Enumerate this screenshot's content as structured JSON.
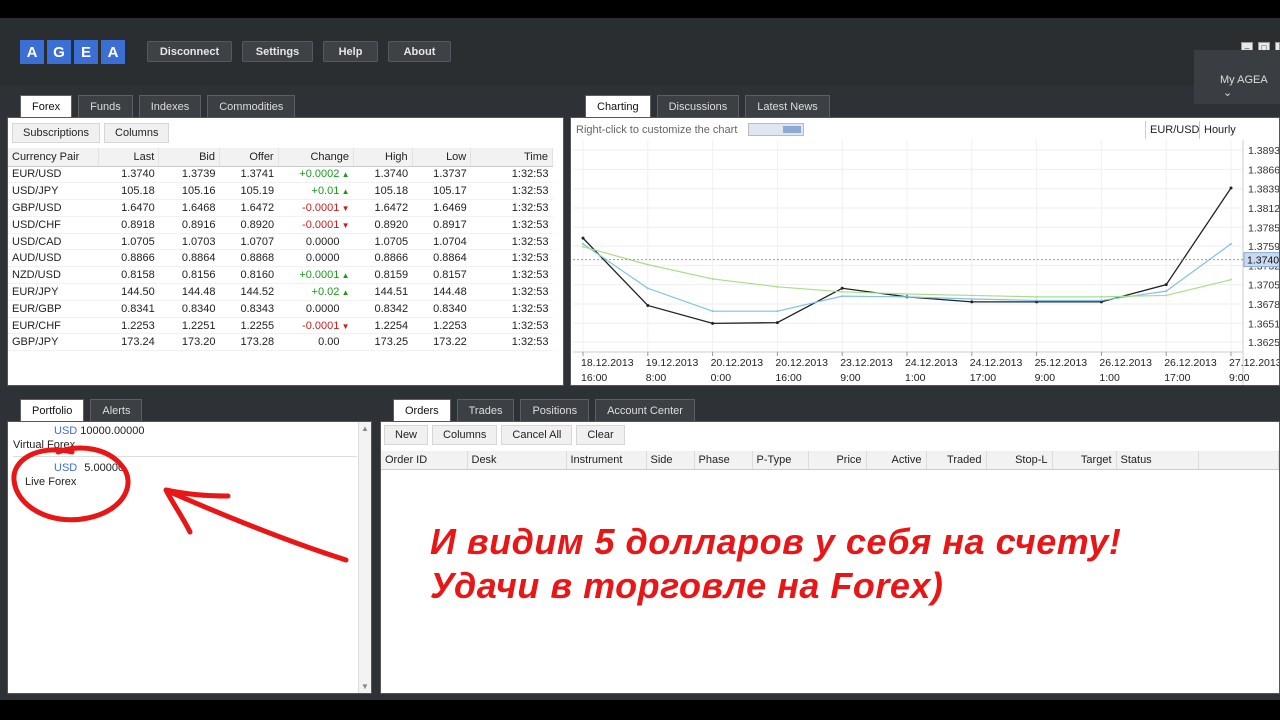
{
  "logo": [
    "A",
    "G",
    "E",
    "A"
  ],
  "topbar": {
    "disconnect": "Disconnect",
    "settings": "Settings",
    "help": "Help",
    "about": "About",
    "my_agea": "My AGEA"
  },
  "quotes": {
    "tabs": [
      "Forex",
      "Funds",
      "Indexes",
      "Commodities"
    ],
    "subscriptions": "Subscriptions",
    "columns": "Columns",
    "headers": [
      "Currency Pair",
      "Last",
      "Bid",
      "Offer",
      "Change",
      "High",
      "Low",
      "Time"
    ],
    "rows": [
      {
        "pair": "EUR/USD",
        "last": "1.3740",
        "bid": "1.3739",
        "offer": "1.3741",
        "change": "+0.0002",
        "dir": "up",
        "high": "1.3740",
        "low": "1.3737",
        "time": "1:32:53"
      },
      {
        "pair": "USD/JPY",
        "last": "105.18",
        "bid": "105.16",
        "offer": "105.19",
        "change": "+0.01",
        "dir": "up",
        "high": "105.18",
        "low": "105.17",
        "time": "1:32:53"
      },
      {
        "pair": "GBP/USD",
        "last": "1.6470",
        "bid": "1.6468",
        "offer": "1.6472",
        "change": "-0.0001",
        "dir": "down",
        "high": "1.6472",
        "low": "1.6469",
        "time": "1:32:53"
      },
      {
        "pair": "USD/CHF",
        "last": "0.8918",
        "bid": "0.8916",
        "offer": "0.8920",
        "change": "-0.0001",
        "dir": "down",
        "high": "0.8920",
        "low": "0.8917",
        "time": "1:32:53"
      },
      {
        "pair": "USD/CAD",
        "last": "1.0705",
        "bid": "1.0703",
        "offer": "1.0707",
        "change": "0.0000",
        "dir": "",
        "high": "1.0705",
        "low": "1.0704",
        "time": "1:32:53"
      },
      {
        "pair": "AUD/USD",
        "last": "0.8866",
        "bid": "0.8864",
        "offer": "0.8868",
        "change": "0.0000",
        "dir": "",
        "high": "0.8866",
        "low": "0.8864",
        "time": "1:32:53"
      },
      {
        "pair": "NZD/USD",
        "last": "0.8158",
        "bid": "0.8156",
        "offer": "0.8160",
        "change": "+0.0001",
        "dir": "up",
        "high": "0.8159",
        "low": "0.8157",
        "time": "1:32:53"
      },
      {
        "pair": "EUR/JPY",
        "last": "144.50",
        "bid": "144.48",
        "offer": "144.52",
        "change": "+0.02",
        "dir": "up",
        "high": "144.51",
        "low": "144.48",
        "time": "1:32:53"
      },
      {
        "pair": "EUR/GBP",
        "last": "0.8341",
        "bid": "0.8340",
        "offer": "0.8343",
        "change": "0.0000",
        "dir": "",
        "high": "0.8342",
        "low": "0.8340",
        "time": "1:32:53"
      },
      {
        "pair": "EUR/CHF",
        "last": "1.2253",
        "bid": "1.2251",
        "offer": "1.2255",
        "change": "-0.0001",
        "dir": "down",
        "high": "1.2254",
        "low": "1.2253",
        "time": "1:32:53"
      },
      {
        "pair": "GBP/JPY",
        "last": "173.24",
        "bid": "173.20",
        "offer": "173.28",
        "change": "0.00",
        "dir": "",
        "high": "173.25",
        "low": "173.22",
        "time": "1:32:53"
      }
    ]
  },
  "chart": {
    "tabs": [
      "Charting",
      "Discussions",
      "Latest News"
    ],
    "hint": "Right-click to customize the chart",
    "symbol": "EUR/USD",
    "interval": "Hourly",
    "yticks": [
      "1.3893",
      "1.3866",
      "1.3839",
      "1.3812",
      "1.3785",
      "1.3759",
      "1.3732",
      "1.3705",
      "1.3678",
      "1.3651",
      "1.3625"
    ],
    "last_price": "1.3740",
    "xticks": [
      [
        "18.12.2013",
        "16:00"
      ],
      [
        "19.12.2013",
        "8:00"
      ],
      [
        "20.12.2013",
        "0:00"
      ],
      [
        "20.12.2013",
        "16:00"
      ],
      [
        "23.12.2013",
        "9:00"
      ],
      [
        "24.12.2013",
        "1:00"
      ],
      [
        "24.12.2013",
        "17:00"
      ],
      [
        "25.12.2013",
        "9:00"
      ],
      [
        "26.12.2013",
        "1:00"
      ],
      [
        "26.12.2013",
        "17:00"
      ],
      [
        "27.12.2013",
        "9:00"
      ]
    ]
  },
  "chart_data": {
    "type": "line",
    "title": "",
    "xlabel": "",
    "ylabel": "",
    "ylim": [
      1.3611,
      1.3907
    ],
    "x": [
      "18.12.2013 16:00",
      "19.12.2013 8:00",
      "20.12.2013 0:00",
      "20.12.2013 16:00",
      "23.12.2013 9:00",
      "24.12.2013 1:00",
      "24.12.2013 17:00",
      "25.12.2013 9:00",
      "26.12.2013 1:00",
      "26.12.2013 17:00",
      "27.12.2013 9:00"
    ],
    "series": [
      {
        "color": "#222222",
        "values": [
          1.377,
          1.3676,
          1.3651,
          1.3652,
          1.37,
          1.3688,
          1.3681,
          1.3681,
          1.3681,
          1.3705,
          1.384
        ]
      },
      {
        "color": "#7ec3e6",
        "values": [
          1.3762,
          1.37,
          1.3668,
          1.3668,
          1.3689,
          1.3688,
          1.3685,
          1.3683,
          1.3683,
          1.3696,
          1.3762
        ]
      },
      {
        "color": "#a8dd8a",
        "values": [
          1.3758,
          1.3733,
          1.3713,
          1.3702,
          1.3695,
          1.3692,
          1.369,
          1.3688,
          1.3688,
          1.369,
          1.3712
        ]
      }
    ]
  },
  "portfolio": {
    "tabs": [
      "Portfolio",
      "Alerts"
    ],
    "accounts": [
      {
        "currency": "USD",
        "amount": "10000.00000",
        "name": "Virtual Forex"
      },
      {
        "currency": "USD",
        "amount": "5.00000",
        "name": "Live Forex"
      }
    ]
  },
  "orders": {
    "tabs": [
      "Orders",
      "Trades",
      "Positions",
      "Account Center"
    ],
    "buttons": [
      "New",
      "Columns",
      "Cancel All",
      "Clear"
    ],
    "headers": [
      "Order ID",
      "Desk",
      "Instrument",
      "Side",
      "Phase",
      "P-Type",
      "Price",
      "Active",
      "Traded",
      "Stop-L",
      "Target",
      "Status"
    ]
  },
  "annotation": {
    "line1": "И видим 5 долларов у себя на счету!",
    "line2": "Удачи в торговле на Forex)"
  },
  "colors": {
    "accent": "#3c6fd4",
    "annotation": "#e81616",
    "up": "#1a9c1a",
    "down": "#c81e1e"
  }
}
